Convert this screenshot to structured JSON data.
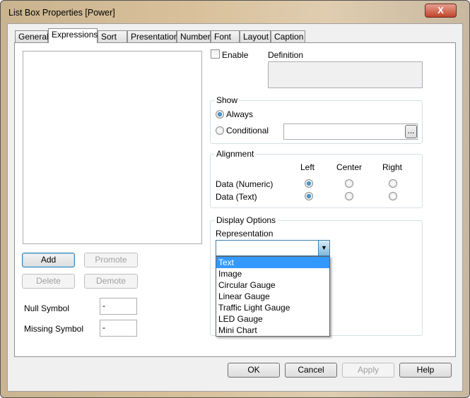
{
  "window": {
    "title": "List Box Properties [Power]",
    "close": "X"
  },
  "tabs": [
    "General",
    "Expressions",
    "Sort",
    "Presentation",
    "Number",
    "Font",
    "Layout",
    "Caption"
  ],
  "left": {
    "add": "Add",
    "promote": "Promote",
    "delete": "Delete",
    "demote": "Demote",
    "null_symbol_label": "Null Symbol",
    "null_symbol_value": "-",
    "missing_symbol_label": "Missing Symbol",
    "missing_symbol_value": "-"
  },
  "enable_label": "Enable",
  "definition_label": "Definition",
  "show": {
    "title": "Show",
    "always": "Always",
    "conditional": "Conditional",
    "browse": "..."
  },
  "alignment": {
    "title": "Alignment",
    "left": "Left",
    "center": "Center",
    "right": "Right",
    "row_numeric": "Data (Numeric)",
    "row_text": "Data (Text)"
  },
  "display": {
    "title": "Display Options",
    "representation": "Representation",
    "options": [
      "Text",
      "Image",
      "Circular Gauge",
      "Linear Gauge",
      "Traffic Light Gauge",
      "LED Gauge",
      "Mini Chart"
    ]
  },
  "footer": {
    "ok": "OK",
    "cancel": "Cancel",
    "apply": "Apply",
    "help": "Help"
  }
}
